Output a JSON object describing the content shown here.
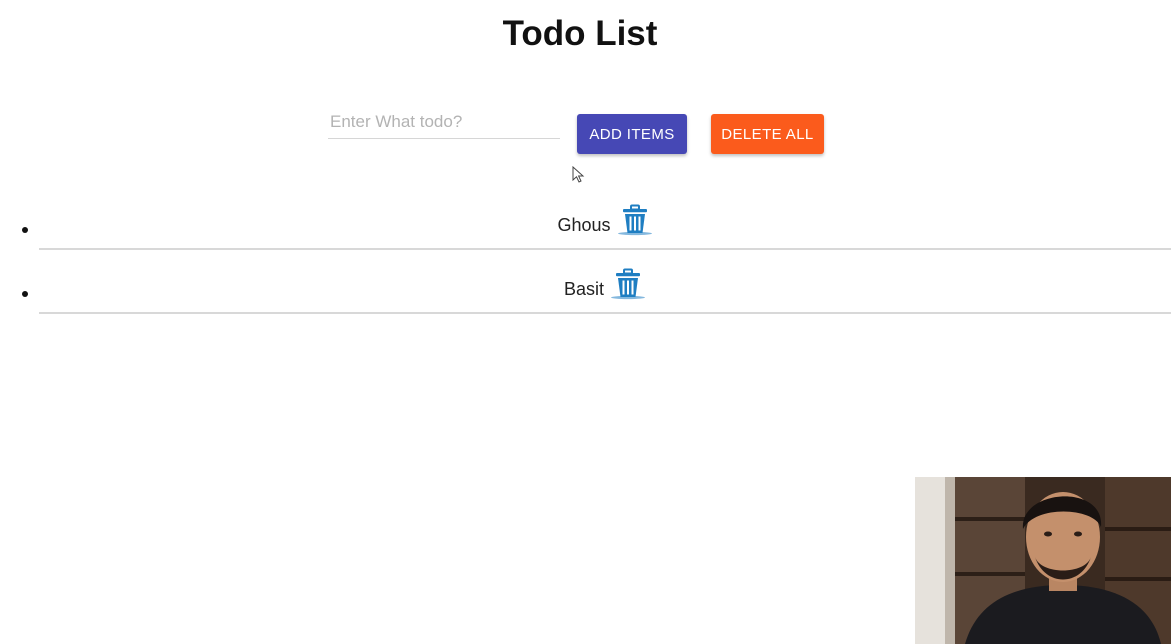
{
  "header": {
    "title": "Todo List"
  },
  "form": {
    "input_value": "",
    "input_placeholder": "Enter What todo?",
    "add_button_label": "ADD ITEMS",
    "delete_all_button_label": "DELETE ALL"
  },
  "todos": [
    {
      "text": "Ghous",
      "icon": "trash-icon"
    },
    {
      "text": "Basit",
      "icon": "trash-icon"
    }
  ],
  "colors": {
    "add_button": "#4648b5",
    "delete_all_button": "#fb5b1c",
    "trash_icon": "#1f7ec2"
  }
}
